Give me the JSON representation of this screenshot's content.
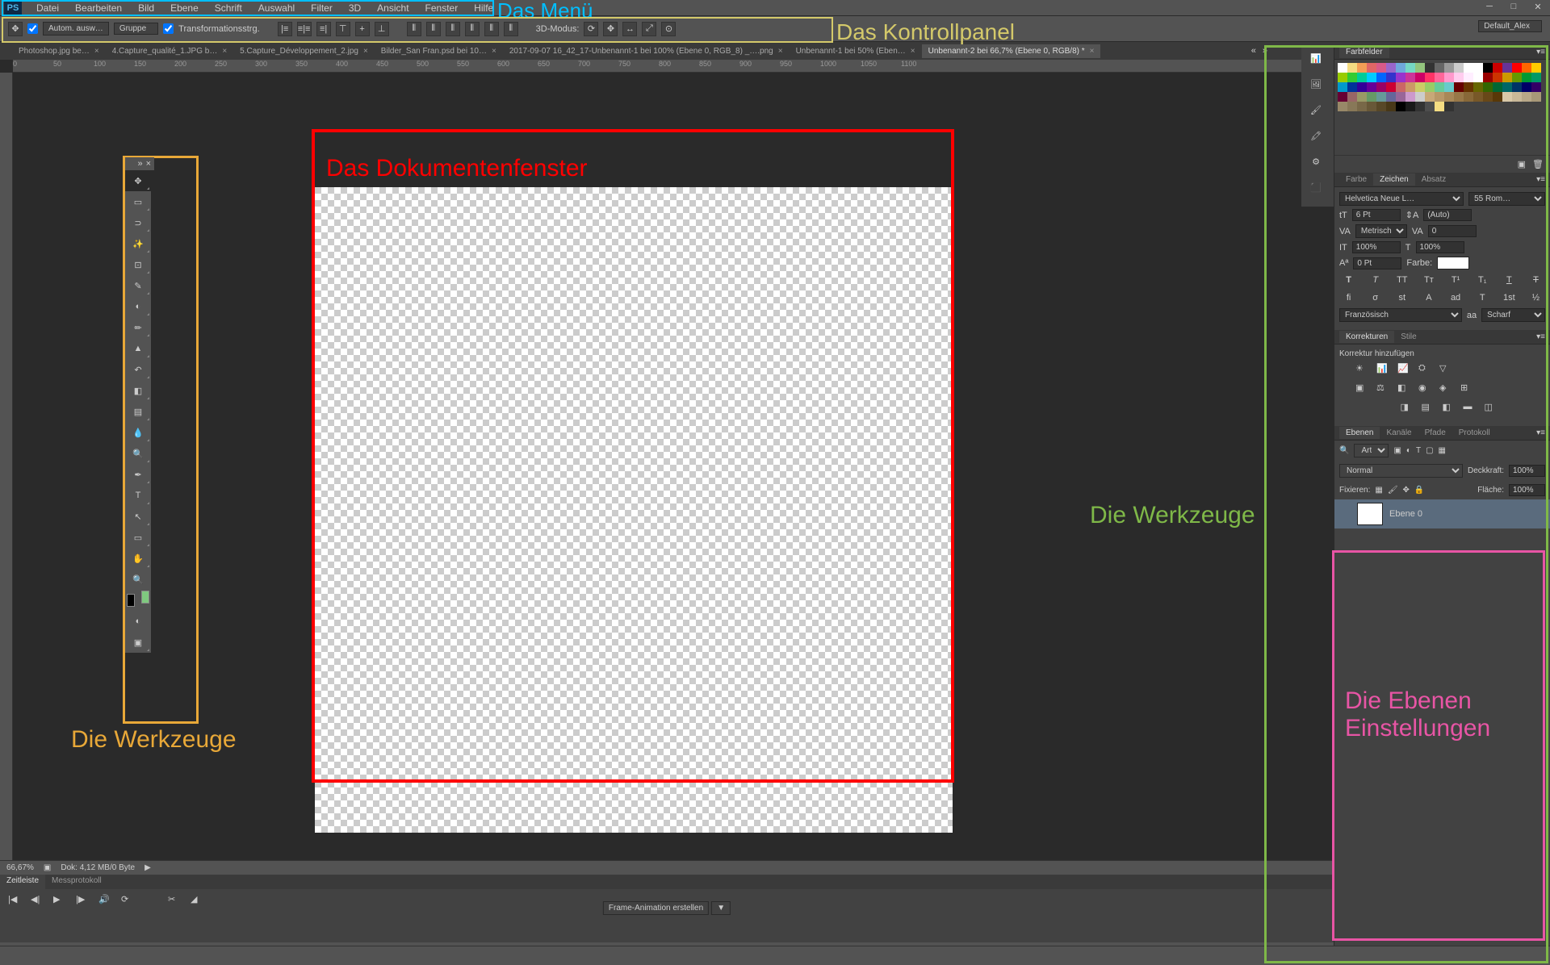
{
  "menu": {
    "logo": "PS",
    "items": [
      "Datei",
      "Bearbeiten",
      "Bild",
      "Ebene",
      "Schrift",
      "Auswahl",
      "Filter",
      "3D",
      "Ansicht",
      "Fenster",
      "Hilfe"
    ]
  },
  "control_panel": {
    "auto_select": "Autom. ausw…",
    "group": "Gruppe",
    "transform": "Transformationsstrg.",
    "mode3d": "3D-Modus:",
    "workspace": "Default_Alex"
  },
  "tabs": [
    {
      "label": "Photoshop.jpg be…"
    },
    {
      "label": "4.Capture_qualité_1.JPG b…"
    },
    {
      "label": "5.Capture_Développement_2.jpg"
    },
    {
      "label": "Bilder_San Fran.psd bei 10…"
    },
    {
      "label": "2017-09-07 16_42_17-Unbenannt-1 bei 100% (Ebene 0, RGB_8) _….png"
    },
    {
      "label": "Unbenannt-1 bei 50% (Eben…"
    },
    {
      "label": "Unbenannt-2 bei 66,7% (Ebene 0, RGB/8) *",
      "active": true
    }
  ],
  "ruler_marks": [
    "0",
    "50",
    "100",
    "150",
    "200",
    "250",
    "300",
    "350",
    "400",
    "450",
    "500",
    "550",
    "600",
    "650",
    "700",
    "750",
    "800",
    "850",
    "900",
    "950",
    "1000",
    "1050",
    "1100"
  ],
  "panels": {
    "swatches": {
      "title": "Farbfelder"
    },
    "char_tabs": [
      "Farbe",
      "Zeichen",
      "Absatz"
    ],
    "char": {
      "font": "Helvetica Neue L…",
      "weight": "55 Rom…",
      "size": "6 Pt",
      "leading": "(Auto)",
      "kerning": "Metrisch",
      "tracking": "0",
      "vscale": "100%",
      "hscale": "100%",
      "baseline": "0 Pt",
      "color_label": "Farbe:",
      "lang": "Französisch",
      "aa_label": "aa",
      "aa": "Scharf"
    },
    "adj_tabs": [
      "Korrekturen",
      "Stile"
    ],
    "adj": {
      "add_label": "Korrektur hinzufügen"
    },
    "layers_tabs": [
      "Ebenen",
      "Kanäle",
      "Pfade",
      "Protokoll"
    ],
    "layers": {
      "filter": "Art",
      "mode": "Normal",
      "opacity_label": "Deckkraft:",
      "opacity": "100%",
      "lock_label": "Fixieren:",
      "fill_label": "Fläche:",
      "fill": "100%",
      "layer_name": "Ebene 0"
    }
  },
  "status": {
    "zoom": "66,67%",
    "doc": "Dok: 4,12 MB/0 Byte"
  },
  "timeline": {
    "tabs": [
      "Zeitleiste",
      "Messprotokoll"
    ],
    "frame_button": "Frame-Animation erstellen"
  },
  "annotations": {
    "menu": "Das Menü",
    "control": "Das Kontrollpanel",
    "document": "Das Dokumentenfenster",
    "tools": "Die Werkzeuge",
    "tools2": "Die Werkzeuge",
    "layers": "Die Ebenen Einstellungen"
  },
  "swatch_colors": [
    "#ffffff",
    "#f5dc82",
    "#f49e56",
    "#e06666",
    "#d75a8a",
    "#9966cc",
    "#6fa8dc",
    "#76d7c4",
    "#93c47d",
    "#333333",
    "#666666",
    "#999999",
    "#cccccc",
    "#fff",
    "#fff",
    "#000",
    "#cc0000",
    "#663399",
    "#ff0000",
    "#ff6600",
    "#ffcc00",
    "#99cc00",
    "#33cc33",
    "#00cc99",
    "#00ccff",
    "#0066ff",
    "#3333cc",
    "#9933cc",
    "#cc3399",
    "#cc0066",
    "#ff3366",
    "#ff6699",
    "#ff99cc",
    "#ffccee",
    "#ffeeff",
    "#fff",
    "#990000",
    "#cc3300",
    "#cc9900",
    "#669900",
    "#009933",
    "#009966",
    "#0099cc",
    "#003399",
    "#330099",
    "#660099",
    "#990066",
    "#cc0033",
    "#cc6666",
    "#cc9966",
    "#cccc66",
    "#99cc66",
    "#66cc99",
    "#66cccc",
    "#660000",
    "#663300",
    "#666600",
    "#336600",
    "#006633",
    "#006666",
    "#003366",
    "#000066",
    "#330066",
    "#660033",
    "#996666",
    "#999966",
    "#669966",
    "#669999",
    "#666699",
    "#996699",
    "#cc99cc",
    "#cccccc",
    "#c8a878",
    "#b89868",
    "#a88858",
    "#987848",
    "#886838",
    "#785828",
    "#684818",
    "#583808",
    "#d8c8a8",
    "#c8b898",
    "#b8a888",
    "#a89878",
    "#988868",
    "#887858",
    "#786848",
    "#685838",
    "#584828",
    "#483818",
    "#000000",
    "#1a1a1a",
    "#333333",
    "#4d4d4d",
    "#f5dc82",
    "#333"
  ]
}
